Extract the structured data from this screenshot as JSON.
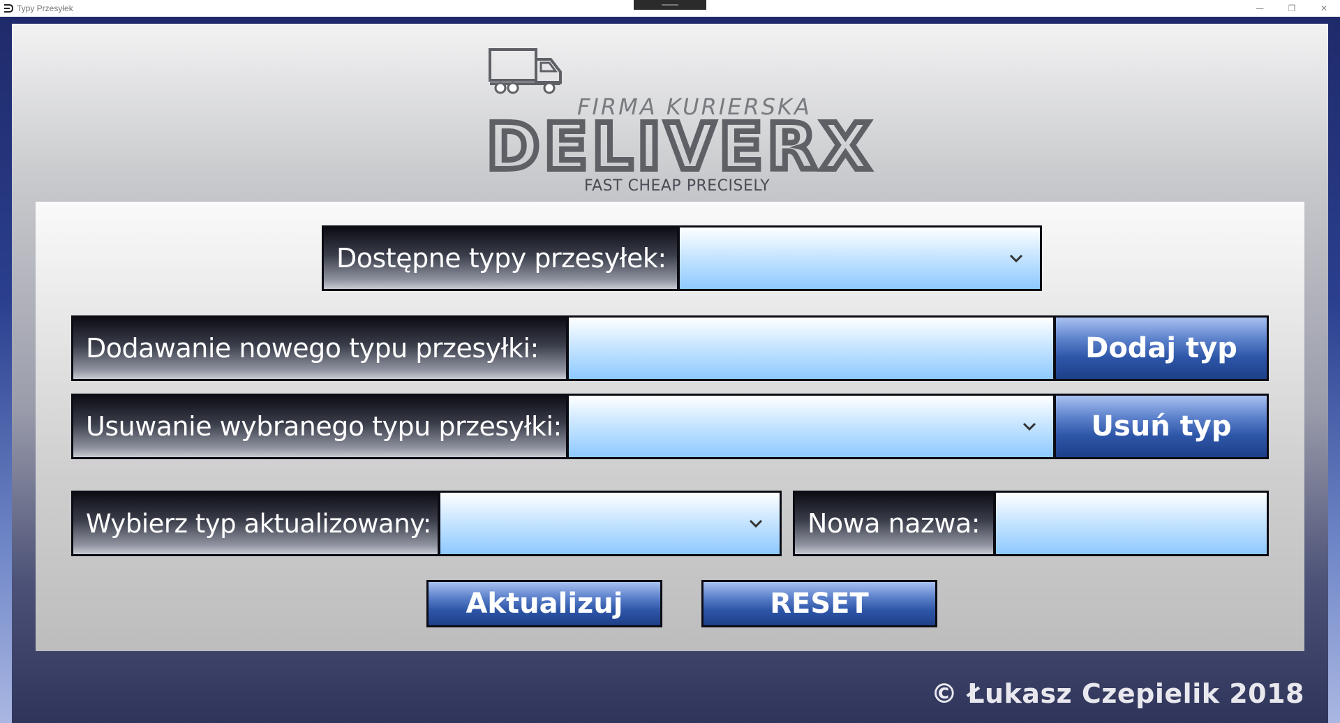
{
  "window": {
    "title": "Typy Przesyłek",
    "controls": {
      "minimize": "—",
      "restore": "❐",
      "close": "✕"
    }
  },
  "logo": {
    "company_line": "FIRMA KURIERSKA",
    "brand": "DELIVERX",
    "tagline": "FAST CHEAP PRECISELY",
    "icon": "truck-icon",
    "color": "#5f6066"
  },
  "form": {
    "available_types": {
      "label": "Dostępne typy przesyłek:",
      "value": ""
    },
    "add_type": {
      "label": "Dodawanie nowego typu przesyłki:",
      "value": "",
      "button": "Dodaj typ"
    },
    "remove_type": {
      "label": "Usuwanie wybranego typu przesyłki:",
      "value": "",
      "button": "Usuń typ"
    },
    "update_select": {
      "label": "Wybierz typ aktualizowany:",
      "value": ""
    },
    "new_name": {
      "label": "Nowa nazwa:",
      "value": ""
    },
    "update_button": "Aktualizuj",
    "reset_button": "RESET"
  },
  "footer": {
    "copyright": "© Łukasz Czepielik 2018"
  },
  "colors": {
    "accent_blue": "#2e56a8",
    "field_blue": "#8ec9ff",
    "label_dark": "#0d0d14"
  }
}
